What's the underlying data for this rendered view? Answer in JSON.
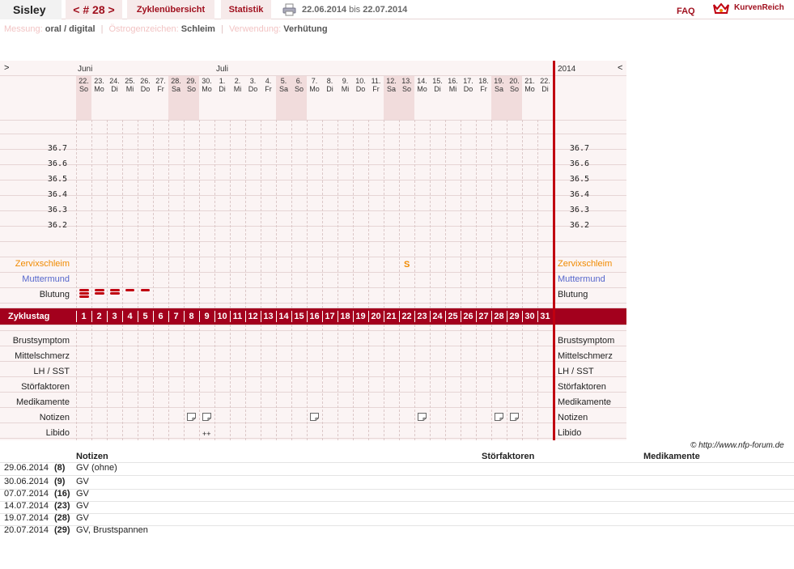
{
  "topbar": {
    "name": "Sisley",
    "cycle_prev": "<",
    "cycle_number": "# 28",
    "cycle_next": ">",
    "zyklen_label": "Zyklenübersicht",
    "statistik_label": "Statistik",
    "date_from": "22.06.2014",
    "date_bis": "bis",
    "date_to": "22.07.2014",
    "faq_label": "FAQ",
    "logo_text": "KurvenReich"
  },
  "settings": {
    "messung_label": "Messung:",
    "messung_value": "oral / digital",
    "oestrogen_label": "Östrogenzeichen:",
    "oestrogen_value": "Schleim",
    "verwendung_label": "Verwendung:",
    "verwendung_value": "Verhütung"
  },
  "chart": {
    "nav_left": ">",
    "nav_right": "<",
    "months": [
      "Juni",
      "Juli"
    ],
    "year": "2014",
    "days": [
      {
        "d": "22.",
        "w": "So",
        "we": true
      },
      {
        "d": "23.",
        "w": "Mo",
        "we": false
      },
      {
        "d": "24.",
        "w": "Di",
        "we": false
      },
      {
        "d": "25.",
        "w": "Mi",
        "we": false
      },
      {
        "d": "26.",
        "w": "Do",
        "we": false
      },
      {
        "d": "27.",
        "w": "Fr",
        "we": false
      },
      {
        "d": "28.",
        "w": "Sa",
        "we": true
      },
      {
        "d": "29.",
        "w": "So",
        "we": true
      },
      {
        "d": "30.",
        "w": "Mo",
        "we": false
      },
      {
        "d": "1.",
        "w": "Di",
        "we": false
      },
      {
        "d": "2.",
        "w": "Mi",
        "we": false
      },
      {
        "d": "3.",
        "w": "Do",
        "we": false
      },
      {
        "d": "4.",
        "w": "Fr",
        "we": false
      },
      {
        "d": "5.",
        "w": "Sa",
        "we": true
      },
      {
        "d": "6.",
        "w": "So",
        "we": true
      },
      {
        "d": "7.",
        "w": "Mo",
        "we": false
      },
      {
        "d": "8.",
        "w": "Di",
        "we": false
      },
      {
        "d": "9.",
        "w": "Mi",
        "we": false
      },
      {
        "d": "10.",
        "w": "Do",
        "we": false
      },
      {
        "d": "11.",
        "w": "Fr",
        "we": false
      },
      {
        "d": "12.",
        "w": "Sa",
        "we": true
      },
      {
        "d": "13.",
        "w": "So",
        "we": true
      },
      {
        "d": "14.",
        "w": "Mo",
        "we": false
      },
      {
        "d": "15.",
        "w": "Di",
        "we": false
      },
      {
        "d": "16.",
        "w": "Mi",
        "we": false
      },
      {
        "d": "17.",
        "w": "Do",
        "we": false
      },
      {
        "d": "18.",
        "w": "Fr",
        "we": false
      },
      {
        "d": "19.",
        "w": "Sa",
        "we": true
      },
      {
        "d": "20.",
        "w": "So",
        "we": true
      },
      {
        "d": "21.",
        "w": "Mo",
        "we": false
      },
      {
        "d": "22.",
        "w": "Di",
        "we": false
      }
    ],
    "temperatures": [
      "36.7",
      "36.6",
      "36.5",
      "36.4",
      "36.3",
      "36.2"
    ],
    "rows": {
      "zervix": "Zervixschleim",
      "muttermund": "Muttermund",
      "blutung": "Blutung",
      "zyklustag": "Zyklustag",
      "brust": "Brustsymptom",
      "mittel": "Mittelschmerz",
      "lh": "LH / SST",
      "stoer": "Störfaktoren",
      "medi": "Medikamente",
      "notizen": "Notizen",
      "libido": "Libido"
    },
    "cycle_days": [
      "1",
      "2",
      "3",
      "4",
      "5",
      "6",
      "7",
      "8",
      "9",
      "10",
      "11",
      "12",
      "13",
      "14",
      "15",
      "16",
      "17",
      "18",
      "19",
      "20",
      "21",
      "22",
      "23",
      "24",
      "25",
      "26",
      "27",
      "28",
      "29",
      "30",
      "31"
    ],
    "bleeding": [
      {
        "day": 1,
        "intensity": 3
      },
      {
        "day": 2,
        "intensity": 2
      },
      {
        "day": 3,
        "intensity": 2
      },
      {
        "day": 4,
        "intensity": 1
      },
      {
        "day": 5,
        "intensity": 1
      }
    ],
    "mucus": [
      {
        "day": 22,
        "symbol": "S"
      }
    ],
    "notes_days": [
      8,
      9,
      16,
      23,
      28,
      29
    ],
    "libido": [
      {
        "day": 9,
        "value": "++"
      }
    ]
  },
  "copyright": "© http://www.nfp-forum.de",
  "table": {
    "headers": {
      "notizen": "Notizen",
      "stoer": "Störfaktoren",
      "medi": "Medikamente"
    },
    "rows": [
      {
        "date": "29.06.2014",
        "cycle": "(8)",
        "text": "GV (ohne)"
      },
      {
        "date": "30.06.2014",
        "cycle": "(9)",
        "text": "GV"
      },
      {
        "date": "07.07.2014",
        "cycle": "(16)",
        "text": "GV"
      },
      {
        "date": "14.07.2014",
        "cycle": "(23)",
        "text": "GV"
      },
      {
        "date": "19.07.2014",
        "cycle": "(28)",
        "text": "GV"
      },
      {
        "date": "20.07.2014",
        "cycle": "(29)",
        "text": "GV, Brustspannen"
      }
    ]
  },
  "colors": {
    "accent": "#a3001d",
    "redline": "#c00010",
    "orange": "#f08a00",
    "blue": "#5566cc",
    "chart_bg": "#fbf4f4",
    "weekend": "#f1dcdc"
  }
}
